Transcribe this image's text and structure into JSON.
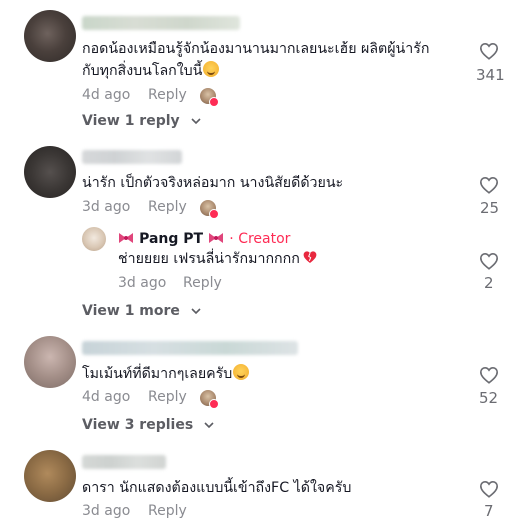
{
  "comments": [
    {
      "text_line1": "กอดน้องเหมือนรู้จักน้องมานานมากเลยนะเฮ้ย ผลิตผู้น่ารัก",
      "text_line2": "กับทุกสิ่งบนโลกใบนี้",
      "emoji": "smiling-face-with-hearts",
      "age": "4d ago",
      "reply_label": "Reply",
      "likes": "341",
      "view_replies": "View 1 reply"
    },
    {
      "text_line1": "น่ารัก เป็กตัวจริงหล่อมาก นางนิสัยดีด้วยนะ",
      "age": "3d ago",
      "reply_label": "Reply",
      "likes": "25",
      "creator_reply": {
        "name": "Pang PT",
        "tag": "· Creator",
        "text": "ช่ายยยย เฟรนลี่น่ารักมากกกก",
        "emoji": "mending-heart",
        "age": "3d ago",
        "reply_label": "Reply",
        "likes": "2"
      },
      "view_more": "View 1 more"
    },
    {
      "text_line1": "โมเม้นท์ที่ดีมากๆเลยครับ",
      "emoji": "smiling-face-with-hearts",
      "age": "4d ago",
      "reply_label": "Reply",
      "likes": "52",
      "view_replies": "View 3 replies"
    },
    {
      "text_line1": "ดารา นักแสดงต้องแบบนี้เข้าถึงFC ได้ใจครับ",
      "age": "3d ago",
      "reply_label": "Reply",
      "likes": "7"
    }
  ],
  "icons": {
    "like": "heart-outline-icon",
    "expand": "chevron-down-icon",
    "creator_badge": "bow-icon"
  },
  "colors": {
    "creator_accent": "#fe2c55",
    "meta_text": "#8a8b91",
    "body_text": "#161823"
  }
}
